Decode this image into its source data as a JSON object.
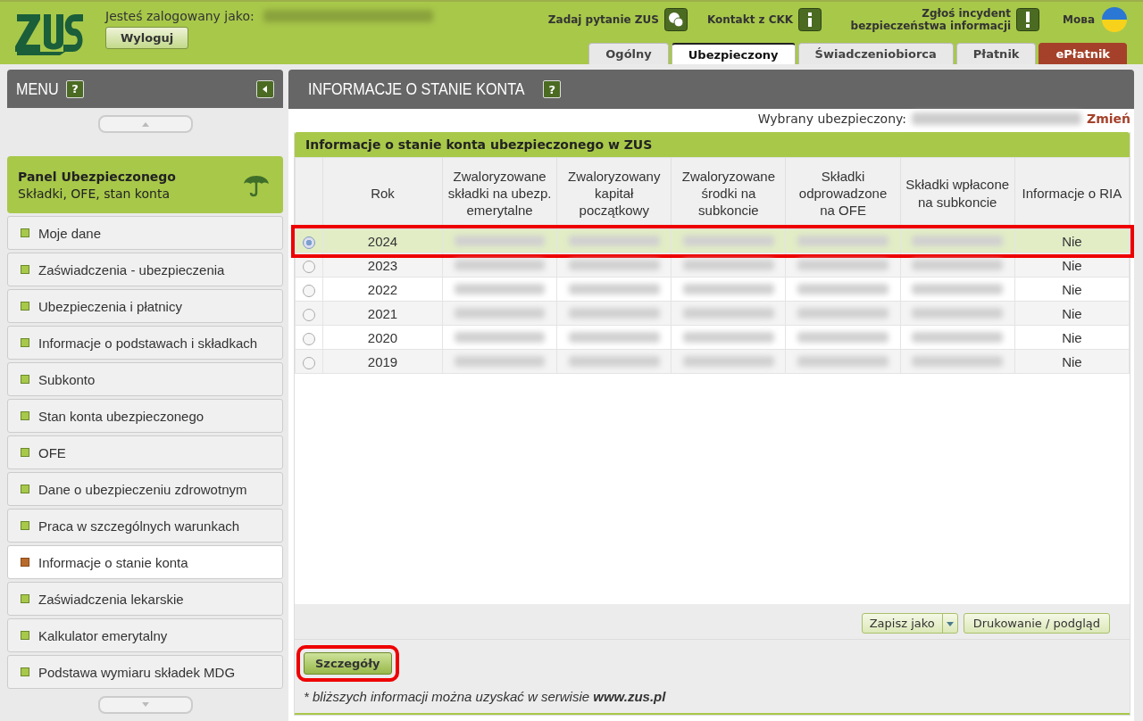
{
  "header": {
    "logged_in_label": "Jesteś zalogowany jako:",
    "logout_button": "Wyloguj",
    "links": [
      {
        "label": "Zadaj pytanie ZUS",
        "kind": "chat"
      },
      {
        "label": "Kontakt z CKK",
        "kind": "info"
      },
      {
        "label": "Zgłoś incydent bezpieczeństwa informacji",
        "kind": "alert"
      }
    ],
    "language": "Мова"
  },
  "tabs": [
    {
      "label": "Ogólny",
      "selected": false,
      "kind": "normal"
    },
    {
      "label": "Ubezpieczony",
      "selected": true,
      "kind": "normal"
    },
    {
      "label": "Świadczeniobiorca",
      "selected": false,
      "kind": "normal"
    },
    {
      "label": "Płatnik",
      "selected": false,
      "kind": "normal"
    },
    {
      "label": "ePłatnik",
      "selected": false,
      "kind": "special"
    }
  ],
  "sidebar": {
    "title": "MENU",
    "help": "?",
    "panel": {
      "title": "Panel Ubezpieczonego",
      "subtitle": "Składki, OFE, stan konta"
    },
    "items": [
      {
        "label": "Moje dane",
        "selected": false
      },
      {
        "label": "Zaświadczenia - ubezpieczenia",
        "selected": false
      },
      {
        "label": "Ubezpieczenia i płatnicy",
        "selected": false
      },
      {
        "label": "Informacje o podstawach i składkach",
        "selected": false
      },
      {
        "label": "Subkonto",
        "selected": false
      },
      {
        "label": "Stan konta ubezpieczonego",
        "selected": false
      },
      {
        "label": "OFE",
        "selected": false
      },
      {
        "label": "Dane o ubezpieczeniu zdrowotnym",
        "selected": false
      },
      {
        "label": "Praca w szczególnych warunkach",
        "selected": false
      },
      {
        "label": "Informacje o stanie konta",
        "selected": true
      },
      {
        "label": "Zaświadczenia lekarskie",
        "selected": false
      },
      {
        "label": "Kalkulator emerytalny",
        "selected": false
      },
      {
        "label": "Podstawa wymiaru składek MDG",
        "selected": false
      }
    ]
  },
  "main": {
    "title": "INFORMACJE O STANIE KONTA",
    "help": "?",
    "selected_insured_label": "Wybrany ubezpieczony:",
    "change_link": "Zmień",
    "table": {
      "title": "Informacje o stanie konta ubezpieczonego w ZUS",
      "columns": [
        {
          "label": "Rok",
          "kind": "year"
        },
        {
          "label": "Zwaloryzowane składki na ubezp. emerytalne",
          "kind": "value"
        },
        {
          "label": "Zwaloryzowany kapitał początkowy",
          "kind": "value"
        },
        {
          "label": "Zwaloryzowane środki na subkoncie",
          "kind": "value"
        },
        {
          "label": "Składki odprowadzone na OFE",
          "kind": "value"
        },
        {
          "label": "Składki wpłacone na subkoncie",
          "kind": "value"
        },
        {
          "label": "Informacje o RIA",
          "kind": "ria"
        }
      ],
      "rows": [
        {
          "year": "2024",
          "ria": "Nie",
          "selected": true,
          "highlighted": true
        },
        {
          "year": "2023",
          "ria": "Nie",
          "selected": false,
          "highlighted": false
        },
        {
          "year": "2022",
          "ria": "Nie",
          "selected": false,
          "highlighted": false
        },
        {
          "year": "2021",
          "ria": "Nie",
          "selected": false,
          "highlighted": false
        },
        {
          "year": "2020",
          "ria": "Nie",
          "selected": false,
          "highlighted": false
        },
        {
          "year": "2019",
          "ria": "Nie",
          "selected": false,
          "highlighted": false
        }
      ]
    },
    "save_button": "Zapisz jako",
    "print_button": "Drukowanie / podgląd",
    "details_button": {
      "label": "Szczegóły",
      "highlighted": true
    },
    "footnote": "* bliższych informacji można uzyskać w serwisie **www.zus.pl**"
  }
}
